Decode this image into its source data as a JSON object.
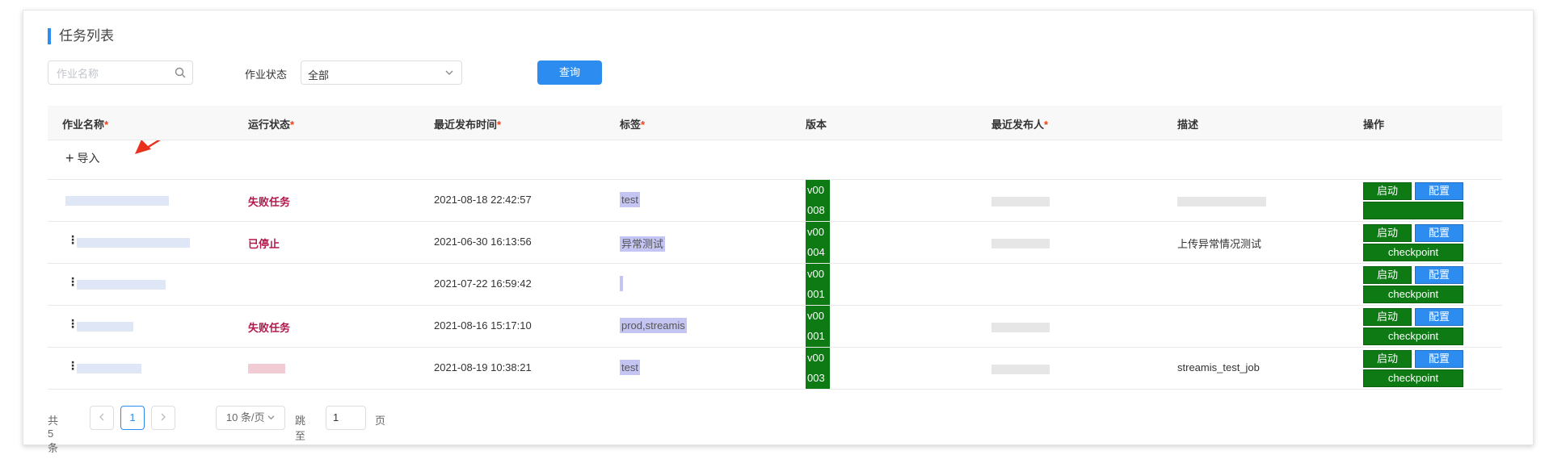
{
  "section": {
    "title": "任务列表"
  },
  "filters": {
    "name_placeholder": "作业名称",
    "status_label": "作业状态",
    "status_value": "全部",
    "query_label": "查询"
  },
  "table": {
    "headers": [
      {
        "label": "作业名称",
        "required": true
      },
      {
        "label": "运行状态",
        "required": true
      },
      {
        "label": "最近发布时间",
        "required": true
      },
      {
        "label": "标签",
        "required": true
      },
      {
        "label": "版本",
        "required": false
      },
      {
        "label": "最近发布人",
        "required": true
      },
      {
        "label": "描述",
        "required": false
      },
      {
        "label": "操作",
        "required": false
      }
    ],
    "import_label": "导入",
    "rows": [
      {
        "status": "失败任务",
        "published": "2021-08-18 22:42:57",
        "tag": "test",
        "version": [
          "v00",
          "008"
        ],
        "description": "",
        "ops": {
          "start": "启动",
          "config": "配置",
          "checkpoint": ""
        }
      },
      {
        "status": "已停止",
        "published": "2021-06-30 16:13:56",
        "tag": "异常测试",
        "version": [
          "v00",
          "004"
        ],
        "description": "上传异常情况测试",
        "ops": {
          "start": "启动",
          "config": "配置",
          "checkpoint": "checkpoint"
        }
      },
      {
        "status": "",
        "published": "2021-07-22 16:59:42",
        "tag": "",
        "version": [
          "v00",
          "001"
        ],
        "description": "",
        "ops": {
          "start": "启动",
          "config": "配置",
          "checkpoint": "checkpoint"
        }
      },
      {
        "status": "失败任务",
        "published": "2021-08-16 15:17:10",
        "tag": "prod,streamis",
        "version": [
          "v00",
          "001"
        ],
        "description": "",
        "ops": {
          "start": "启动",
          "config": "配置",
          "checkpoint": "checkpoint"
        }
      },
      {
        "status": "",
        "published": "2021-08-19 10:38:21",
        "tag": "test",
        "version": [
          "v00",
          "003"
        ],
        "description": "streamis_test_job",
        "ops": {
          "start": "启动",
          "config": "配置",
          "checkpoint": "checkpoint"
        }
      }
    ]
  },
  "pagination": {
    "total": "共 5 条",
    "current_page": "1",
    "page_size": "10 条/页",
    "jump_label": "跳至",
    "jump_value": "1",
    "page_unit": "页"
  },
  "colors": {
    "primary": "#2d8cf0",
    "start_button": "#0d7a14",
    "status_red": "#b2184c",
    "annotation_arrow": "#e8321e"
  }
}
